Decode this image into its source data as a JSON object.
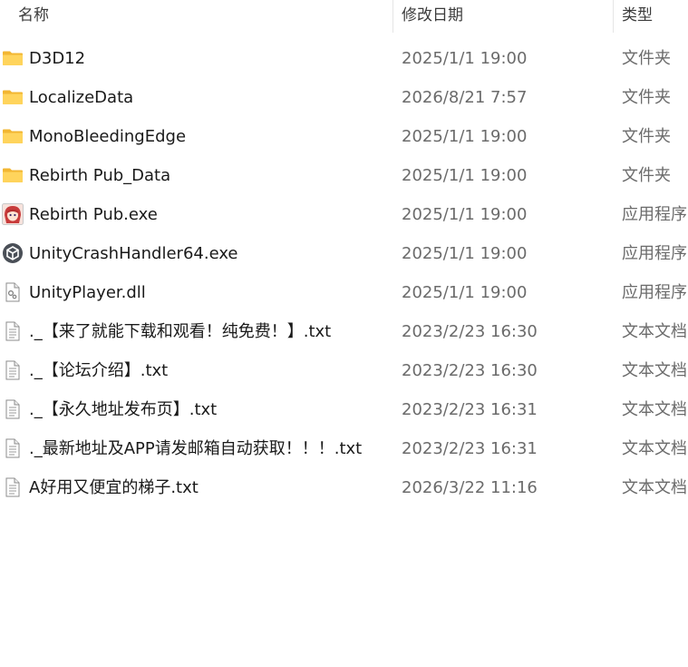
{
  "columns": {
    "name": "名称",
    "date": "修改日期",
    "type": "类型"
  },
  "files": [
    {
      "name": "D3D12",
      "date": "2025/1/1 19:00",
      "type": "文件夹",
      "icon": "folder-icon"
    },
    {
      "name": "LocalizeData",
      "date": "2026/8/21 7:57",
      "type": "文件夹",
      "icon": "folder-icon"
    },
    {
      "name": "MonoBleedingEdge",
      "date": "2025/1/1 19:00",
      "type": "文件夹",
      "icon": "folder-icon"
    },
    {
      "name": "Rebirth Pub_Data",
      "date": "2025/1/1 19:00",
      "type": "文件夹",
      "icon": "folder-icon"
    },
    {
      "name": "Rebirth Pub.exe",
      "date": "2025/1/1 19:00",
      "type": "应用程序",
      "icon": "app-avatar-icon"
    },
    {
      "name": "UnityCrashHandler64.exe",
      "date": "2025/1/1 19:00",
      "type": "应用程序",
      "icon": "unity-icon"
    },
    {
      "name": "UnityPlayer.dll",
      "date": "2025/1/1 19:00",
      "type": "应用程序",
      "icon": "dll-file-icon"
    },
    {
      "name": "._【来了就能下载和观看！纯免费！】.txt",
      "date": "2023/2/23 16:30",
      "type": "文本文档",
      "icon": "text-file-icon"
    },
    {
      "name": "._【论坛介绍】.txt",
      "date": "2023/2/23 16:30",
      "type": "文本文档",
      "icon": "text-file-icon"
    },
    {
      "name": "._【永久地址发布页】.txt",
      "date": "2023/2/23 16:31",
      "type": "文本文档",
      "icon": "text-file-icon"
    },
    {
      "name": "._最新地址及APP请发邮箱自动获取！！！.txt",
      "date": "2023/2/23 16:31",
      "type": "文本文档",
      "icon": "text-file-icon"
    },
    {
      "name": "A好用又便宜的梯子.txt",
      "date": "2026/3/22 11:16",
      "type": "文本文档",
      "icon": "text-file-icon"
    }
  ]
}
